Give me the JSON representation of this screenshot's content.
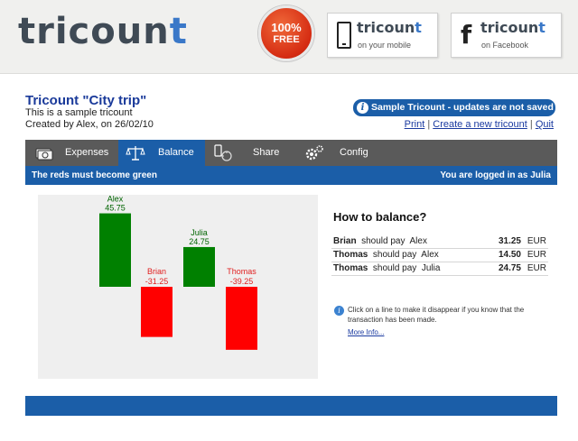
{
  "header": {
    "logo_text": "tricoun",
    "logo_plus": "t",
    "badge": {
      "percent": "100%",
      "free": "FREE"
    },
    "promo_mobile": {
      "brand": "tricoun",
      "brand_plus": "t",
      "sub": "on your mobile",
      "icon": "phone-icon"
    },
    "promo_facebook": {
      "brand": "tricoun",
      "brand_plus": "t",
      "sub": "on Facebook",
      "icon": "facebook-icon",
      "glyph": "f"
    }
  },
  "trip": {
    "title": "Tricount \"City trip\"",
    "description": "This is a sample tricount",
    "created": "Created by Alex, on 26/02/10"
  },
  "notice": "Sample Tricount - updates are not saved !",
  "links": {
    "print": "Print",
    "create": "Create a new tricount",
    "quit": "Quit",
    "sep": "|"
  },
  "nav": {
    "tabs": [
      {
        "label": "Expenses",
        "icon": "money-icon",
        "active": false
      },
      {
        "label": "Balance",
        "icon": "scales-icon",
        "active": true
      },
      {
        "label": "Share",
        "icon": "share-icon",
        "active": false
      },
      {
        "label": "Config",
        "icon": "gear-icon",
        "active": false
      }
    ]
  },
  "subbar": {
    "message": "The reds must become green",
    "logged_prefix": "You are logged in as",
    "user": "Julia"
  },
  "chart_data": {
    "type": "bar",
    "categories": [
      "Alex",
      "Brian",
      "Julia",
      "Thomas"
    ],
    "values": [
      45.75,
      -31.25,
      24.75,
      -39.25
    ],
    "labels": [
      "45.75",
      "-31.25",
      "24.75",
      "-39.25"
    ],
    "colors": {
      "positive": "#008000",
      "negative": "#ff0000",
      "positive_text": "#006400",
      "negative_text": "#e02020"
    },
    "ylim": [
      -50,
      50
    ],
    "title": "",
    "xlabel": "",
    "ylabel": ""
  },
  "balance": {
    "title": "How to balance?",
    "should_pay": "should pay",
    "currency": "EUR",
    "rows": [
      {
        "from": "Brian",
        "to": "Alex",
        "amount": "31.25"
      },
      {
        "from": "Thomas",
        "to": "Alex",
        "amount": "14.50"
      },
      {
        "from": "Thomas",
        "to": "Julia",
        "amount": "24.75"
      }
    ],
    "hint": "Click on a line to make it disappear if you know that the transaction has been made.",
    "more_info": "More Info..."
  }
}
